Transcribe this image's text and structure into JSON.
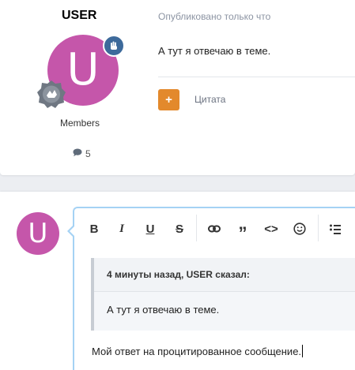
{
  "post": {
    "author": "USER",
    "group": "Members",
    "post_count": "5",
    "date_text": "Опубликовано только что",
    "body": "А тут я отвечаю в теме.",
    "quote_plus": "+",
    "quote_label": "Цитата",
    "avatar_letter": "U",
    "avatar_color": "#c556aa"
  },
  "reply": {
    "avatar_letter": "U",
    "toolbar": {
      "bold": "B",
      "italic": "I",
      "underline": "U",
      "strike": "S",
      "quote": "”",
      "code": "<>"
    },
    "quote_author_line": "4 минуты назад, USER сказал:",
    "quote_text": "А тут я отвечаю в теме.",
    "draft_text": "Мой ответ на процитированное сообщение."
  },
  "colors": {
    "accent_quote": "#e3892c",
    "editor_border": "#a5d2f4",
    "badge_blue": "#3d6a9b"
  }
}
